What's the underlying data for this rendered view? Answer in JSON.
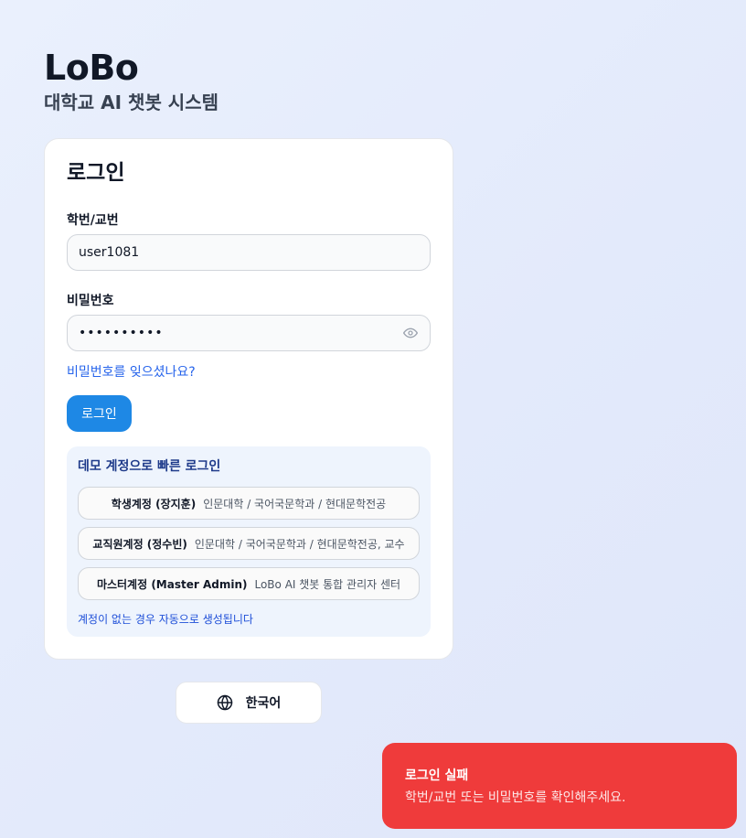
{
  "brand": {
    "title": "LoBo",
    "subtitle": "대학교 AI 챗봇 시스템"
  },
  "login": {
    "title": "로그인",
    "id_label": "학번/교번",
    "id_value": "user1081",
    "pw_label": "비밀번호",
    "pw_value": "••••••••••",
    "forgot_link": "비밀번호를 잊으셨나요?",
    "submit_label": "로그인"
  },
  "demo": {
    "title": "데모 계정으로 빠른 로그인",
    "accounts": [
      {
        "name": "학생계정 (장지훈)",
        "desc": "인문대학 / 국어국문학과 / 현대문학전공"
      },
      {
        "name": "교직원계정 (정수빈)",
        "desc": "인문대학 / 국어국문학과 / 현대문학전공, 교수"
      },
      {
        "name": "마스터계정 (Master Admin)",
        "desc": "LoBo AI 챗봇 통합 관리자 센터"
      }
    ],
    "note": "계정이 없는 경우 자동으로 생성됩니다"
  },
  "language": {
    "label": "한국어",
    "icon": "globe-icon"
  },
  "toast": {
    "title": "로그인 실패",
    "message": "학번/교번 또는 비밀번호를 확인해주세요."
  },
  "colors": {
    "primary": "#1e88e5",
    "link": "#2563eb",
    "error": "#ef3b3b"
  }
}
